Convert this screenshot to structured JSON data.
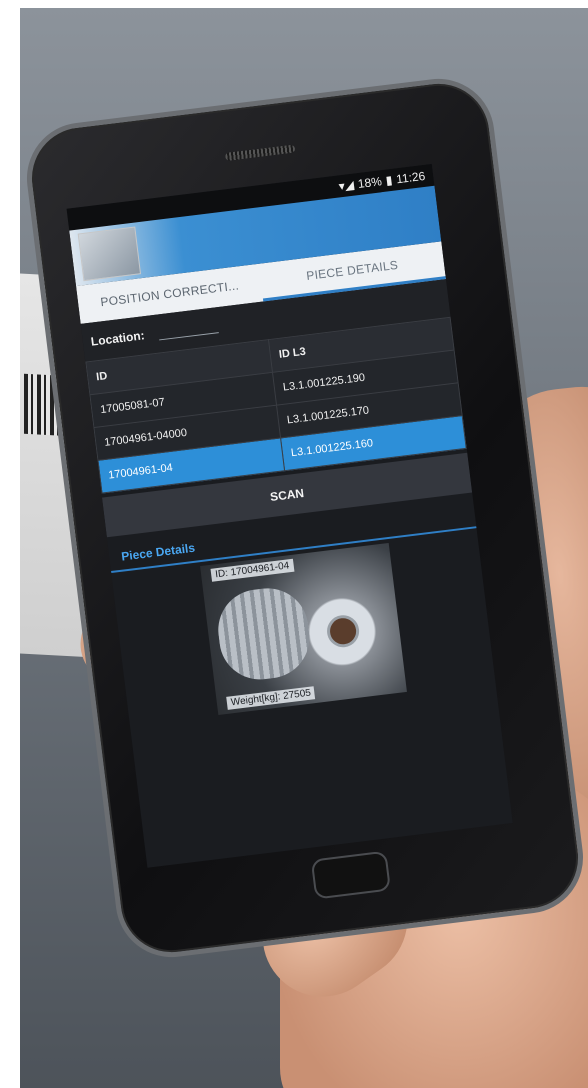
{
  "statusbar": {
    "battery": "18%",
    "time": "11:26"
  },
  "tabs": [
    {
      "label": "POSITION CORRECTI..."
    },
    {
      "label": "PIECE DETAILS"
    }
  ],
  "location": {
    "label": "Location:"
  },
  "table": {
    "headers": [
      "ID",
      "ID L3"
    ],
    "rows": [
      {
        "id": "17005081-07",
        "idl3": "L3.1.001225.190"
      },
      {
        "id": "17004961-04000",
        "idl3": "L3.1.001225.170"
      },
      {
        "id": "17004961-04",
        "idl3": "L3.1.001225.160"
      }
    ]
  },
  "scan_label": "SCAN",
  "piece_details": {
    "title": "Piece Details",
    "id_text": "ID: 17004961-04",
    "weight_text": "Weight[kg]: 27505"
  }
}
